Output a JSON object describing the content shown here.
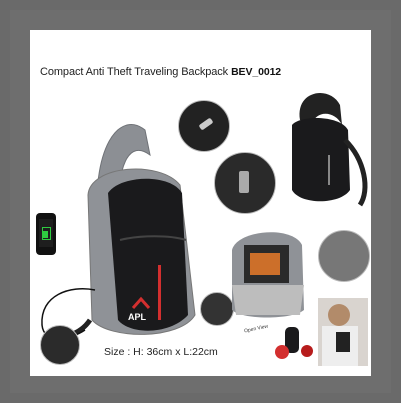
{
  "product": {
    "title": "Compact Anti Theft Traveling Backpack",
    "code": "BEV_0012",
    "size_text": "Size : H: 36cm x L:22cm",
    "brand_logo": "APL",
    "open_view_label": "Open View"
  },
  "colors": {
    "outer_frame": "#6e6e6e",
    "background": "#ffffff",
    "bag_gray": "#8c8f94",
    "bag_black": "#1a1a1c",
    "accent_red": "#d32f2f",
    "usb_green": "#2ecc40"
  },
  "icons": [
    "usb-cable-icon",
    "phone-charging-icon",
    "zipper-lock-icon",
    "usb-port-icon"
  ]
}
